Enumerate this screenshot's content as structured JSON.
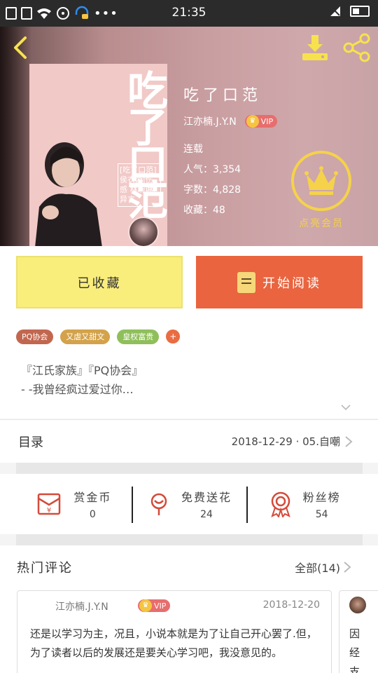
{
  "status_bar": {
    "time": "21:35"
  },
  "book": {
    "title": "吃了口范",
    "author": "江亦楠.J.Y.N",
    "vip_label": "VIP",
    "status": "连载",
    "popularity": "人气：3,354",
    "word_count": "字数：4,828",
    "favorites": "收藏：48",
    "cover_title": "吃了口范",
    "cover_subtitle": "[吃了口范] 侯衣游|伤感 林琬琳|异言"
  },
  "member_button": {
    "label": "点亮会员"
  },
  "actions": {
    "favorited_label": "已收藏",
    "start_reading_label": "开始阅读"
  },
  "tags": [
    "PQ协会",
    "又虐又甜文",
    "皇权富贵"
  ],
  "tag_more": "+",
  "summary": {
    "line1": "『江氏家族』『PQ协会』",
    "line2": "- -我曾经疯过爱过你…"
  },
  "toc": {
    "label": "目录",
    "latest": "2018-12-29 · 05.自嘲"
  },
  "stats": [
    {
      "name": "赏金币",
      "value": "0"
    },
    {
      "name": "免费送花",
      "value": "24"
    },
    {
      "name": "粉丝榜",
      "value": "54"
    }
  ],
  "comments": {
    "title": "热门评论",
    "all_label": "全部(14)",
    "items": [
      {
        "user": "江亦楠.J.Y.N",
        "vip_label": "VIP",
        "date": "2018-12-20",
        "content": "还是以学习为主，况且，小说本就是为了让自己开心罢了.但，为了读者以后的发展还是要关心学习吧，我没意见的。"
      },
      {
        "content": "因经支"
      }
    ]
  },
  "colors": {
    "read_button": "#e9643f",
    "favorite_button": "#f9ee7c",
    "member_gold": "#f5d24a"
  }
}
